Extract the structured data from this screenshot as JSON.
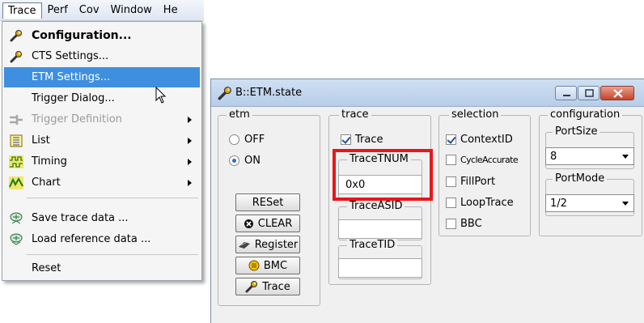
{
  "menubar": {
    "items": [
      "Trace",
      "Perf",
      "Cov",
      "Window",
      "He"
    ],
    "active_index": 0
  },
  "dropdown": {
    "items": [
      {
        "label": "Configuration...",
        "icon": "wrench-icon",
        "bold": true
      },
      {
        "label": "CTS Settings...",
        "icon": "wrench-icon"
      },
      {
        "label": "ETM Settings...",
        "highlighted": true
      },
      {
        "label": "Trigger Dialog..."
      },
      {
        "label": "Trigger Definition",
        "icon": "trigger-icon",
        "disabled": true,
        "submenu": true
      },
      {
        "label": "List",
        "icon": "list-icon",
        "submenu": true
      },
      {
        "label": "Timing",
        "icon": "timing-icon",
        "submenu": true
      },
      {
        "label": "Chart",
        "icon": "chart-icon",
        "submenu": true
      },
      {
        "label": "Save trace data ...",
        "icon": "save-trace-icon"
      },
      {
        "label": "Load reference data ...",
        "icon": "load-reference-icon"
      },
      {
        "label": "Reset"
      }
    ]
  },
  "window": {
    "title": "B::ETM.state",
    "etm": {
      "legend": "etm",
      "options": [
        "OFF",
        "ON"
      ],
      "selected": "ON",
      "buttons": [
        "RESet",
        "CLEAR",
        "Register",
        "BMC",
        "Trace"
      ]
    },
    "trace": {
      "legend": "trace",
      "checkbox_label": "Trace",
      "checked": true,
      "tracetnum_legend": "TraceTNUM",
      "tracetnum_value": "0x0",
      "traceasid_legend": "TraceASID",
      "traceasid_value": "",
      "tracetid_legend": "TraceTID",
      "tracetid_value": ""
    },
    "selection": {
      "legend": "selection",
      "items": [
        {
          "label": "ContextID",
          "checked": true
        },
        {
          "label": "CycleAccurate",
          "checked": false
        },
        {
          "label": "FillPort",
          "checked": false
        },
        {
          "label": "LoopTrace",
          "checked": false
        },
        {
          "label": "BBC",
          "checked": false
        }
      ]
    },
    "configuration": {
      "legend": "configuration",
      "portsize_legend": "PortSize",
      "portsize_value": "8",
      "portmode_legend": "PortMode",
      "portmode_value": "1/2"
    }
  },
  "colors": {
    "menu_highlight": "#3f8fe0",
    "annotation_red": "#e8161b",
    "close_button": "#c7442b"
  }
}
